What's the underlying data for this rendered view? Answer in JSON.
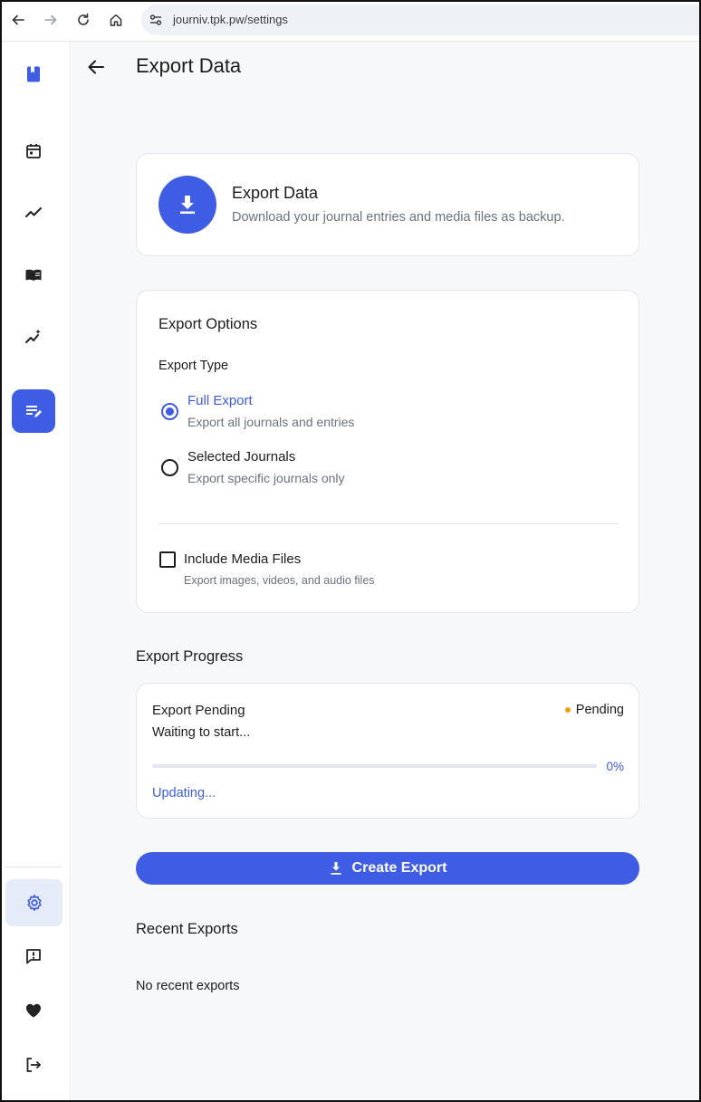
{
  "browser": {
    "url": "journiv.tpk.pw/settings"
  },
  "sidebar": {
    "items": [
      {
        "name": "logo",
        "icon": "book-bookmark-icon"
      },
      {
        "name": "calendar",
        "icon": "calendar-icon"
      },
      {
        "name": "trends",
        "icon": "trend-line-icon"
      },
      {
        "name": "journals",
        "icon": "open-book-icon"
      },
      {
        "name": "insights",
        "icon": "sparkle-chart-icon"
      },
      {
        "name": "notes",
        "icon": "edit-notes-icon",
        "active": true
      }
    ],
    "bottom_items": [
      {
        "name": "settings",
        "icon": "gear-icon",
        "active": true
      },
      {
        "name": "feedback",
        "icon": "feedback-icon"
      },
      {
        "name": "support",
        "icon": "heart-icon"
      },
      {
        "name": "logout",
        "icon": "logout-icon"
      }
    ]
  },
  "header": {
    "title": "Export Data"
  },
  "hero": {
    "title": "Export Data",
    "subtitle": "Download your journal entries and media files as backup."
  },
  "options": {
    "heading": "Export Options",
    "type_label": "Export Type",
    "radios": [
      {
        "title": "Full Export",
        "subtitle": "Export all journals and entries",
        "checked": true
      },
      {
        "title": "Selected Journals",
        "subtitle": "Export specific journals only",
        "checked": false
      }
    ],
    "media": {
      "title": "Include Media Files",
      "subtitle": "Export images, videos, and audio files",
      "checked": false
    }
  },
  "progress": {
    "section_title": "Export Progress",
    "title": "Export Pending",
    "status": "Pending",
    "message": "Waiting to start...",
    "percent_label": "0%",
    "percent": 0,
    "footer": "Updating..."
  },
  "actions": {
    "create_label": "Create Export"
  },
  "recent": {
    "section_title": "Recent Exports",
    "empty": "No recent exports"
  },
  "colors": {
    "accent": "#3e5ce4",
    "pending": "#f59e0b",
    "background": "#f7f8fa"
  }
}
